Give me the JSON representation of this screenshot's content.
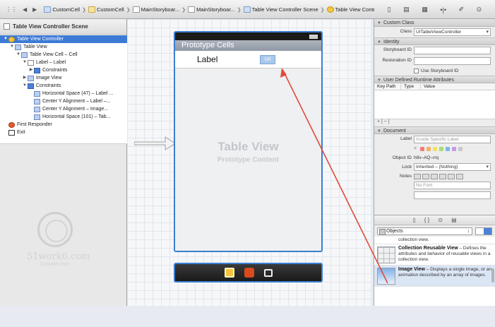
{
  "jumpbar": {
    "nav_grid": "⋮⋮",
    "nav_back": "◀",
    "nav_forward": "▶",
    "crumbs": [
      {
        "label": "CustomCell"
      },
      {
        "label": "CustomCell"
      },
      {
        "label": "MainStoryboar..."
      },
      {
        "label": "MainStoryboar..."
      },
      {
        "label": "Table View Controller Scene"
      },
      {
        "label": "Table View Controller"
      }
    ],
    "right_icons": [
      "▯",
      "▤",
      "▦",
      "•|•",
      "✐",
      "⊙"
    ]
  },
  "outline": {
    "title": "Table View Controller Scene",
    "items": [
      {
        "label": "Table View Controller",
        "depth": 0,
        "tri": "▼",
        "icon": "vc",
        "selected": true
      },
      {
        "label": "Table View",
        "depth": 1,
        "tri": "▼",
        "icon": "item"
      },
      {
        "label": "Table View Cell – Cell",
        "depth": 2,
        "tri": "▼",
        "icon": "item"
      },
      {
        "label": "Label – Label",
        "depth": 3,
        "tri": "▼",
        "icon": "label"
      },
      {
        "label": "Constraints",
        "depth": 4,
        "tri": "▶",
        "icon": "cons"
      },
      {
        "label": "Image View",
        "depth": 3,
        "tri": "▶",
        "icon": "item"
      },
      {
        "label": "Constraints",
        "depth": 3,
        "tri": "▼",
        "icon": "cons"
      },
      {
        "label": "Horizontal Space (47) – Label ...",
        "depth": 4,
        "tri": "",
        "icon": "item"
      },
      {
        "label": "Center Y Alignment – Label –...",
        "depth": 4,
        "tri": "",
        "icon": "item"
      },
      {
        "label": "Center Y Alignment – Image...",
        "depth": 4,
        "tri": "",
        "icon": "item"
      },
      {
        "label": "Horizontal Space (101) – Tab...",
        "depth": 4,
        "tri": "",
        "icon": "item"
      },
      {
        "label": "First Responder",
        "depth": 0,
        "tri": "",
        "icon": "resp"
      },
      {
        "label": "Exit",
        "depth": 0,
        "tri": "",
        "icon": "exit"
      }
    ],
    "watermark_text": "51work6.com",
    "watermark_sub": "51work6.com"
  },
  "canvas": {
    "prototype_header": "Prototype Cells",
    "cell_label": "Label",
    "image_placeholder": "UII",
    "table_view_title": "Table View",
    "table_view_sub": "Prototype Content"
  },
  "inspector": {
    "custom_class": {
      "header": "Custom Class",
      "class_label": "Class",
      "class_value": "UITableViewController"
    },
    "identity": {
      "header": "Identity",
      "storyboard_id_label": "Storyboard ID",
      "restoration_id_label": "Restoration ID",
      "use_storyboard_id": "Use Storyboard ID"
    },
    "udra": {
      "header": "User Defined Runtime Attributes",
      "columns": [
        "Key Path",
        "Type",
        "Value"
      ],
      "footer": "+ | − |"
    },
    "document": {
      "header": "Document",
      "label_label": "Label",
      "label_placeholder": "Xcode Specific Label",
      "swatch_x": "×",
      "swatches": [
        "#f07c7c",
        "#f5b35e",
        "#f3e06a",
        "#a8dd72",
        "#7fb3ee",
        "#c79be8",
        "#c8c8c8"
      ],
      "object_id_label": "Object ID",
      "object_id_value": "h8v–AQ–rrq",
      "lock_label": "Lock",
      "lock_value": "Inherited – (Nothing)",
      "notes_label": "Notes",
      "font_value": "No Font"
    }
  },
  "library": {
    "tabs": [
      "▯",
      "{ }",
      "⊙",
      "▤"
    ],
    "filter_value": "Objects",
    "items": [
      {
        "name": "",
        "desc": "collection view."
      },
      {
        "name": "Collection Reusable View",
        "desc": "– Defines the attributes and behavior of reusable views in a collection view."
      },
      {
        "name": "Image View",
        "desc": "– Displays a single image, or an animation described by an array of images."
      }
    ]
  }
}
